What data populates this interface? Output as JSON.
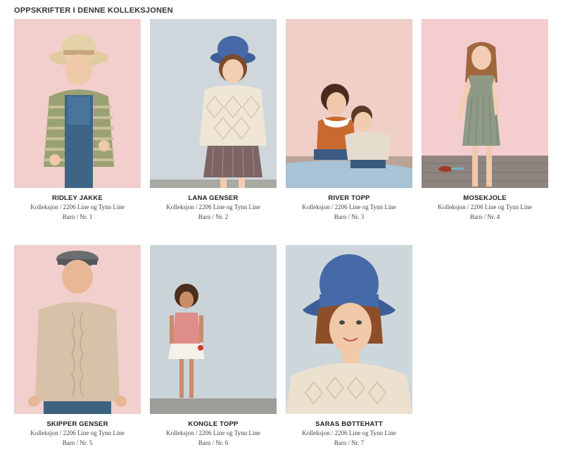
{
  "section_title": "OPPSKRIFTER I DENNE KOLLEKSJONEN",
  "items": [
    {
      "name": "RIDLEY JAKKE",
      "collection": "Kolleksjon / 2206 Line og Tynn Line",
      "category": "Barn / Nr. 1",
      "bg": "#f2cfcc",
      "floor": "#e8c6c2"
    },
    {
      "name": "LANA GENSER",
      "collection": "Kolleksjon / 2206 Line og Tynn Line",
      "category": "Barn / Nr. 2",
      "bg": "#cfd7dc",
      "floor": "#a9a9a4"
    },
    {
      "name": "RIVER TOPP",
      "collection": "Kolleksjon / 2206 Line og Tynn Line",
      "category": "Barn / Nr. 3",
      "bg": "#efcfc8",
      "floor": "#a7c3d5"
    },
    {
      "name": "MOSEKJOLE",
      "collection": "Kolleksjon / 2206 Line og Tynn Line",
      "category": "Barn / Nr. 4",
      "bg": "#f4cdcf",
      "floor": "#8f8580"
    },
    {
      "name": "SKIPPER GENSER",
      "collection": "Kolleksjon / 2206 Line og Tynn Line",
      "category": "Barn / Nr. 5",
      "bg": "#f1cfcc",
      "floor": "#e9c7c4"
    },
    {
      "name": "KONGLE TOPP",
      "collection": "Kolleksjon / 2206 Line og Tynn Line",
      "category": "Barn / Nr. 6",
      "bg": "#cad3d8",
      "floor": "#9c9c99"
    },
    {
      "name": "SARAS BØTTEHATT",
      "collection": "Kolleksjon / 2206 Line og Tynn Line",
      "category": "Barn / Nr. 7",
      "bg": "#cdd6db",
      "floor": "#cdd6db"
    }
  ]
}
